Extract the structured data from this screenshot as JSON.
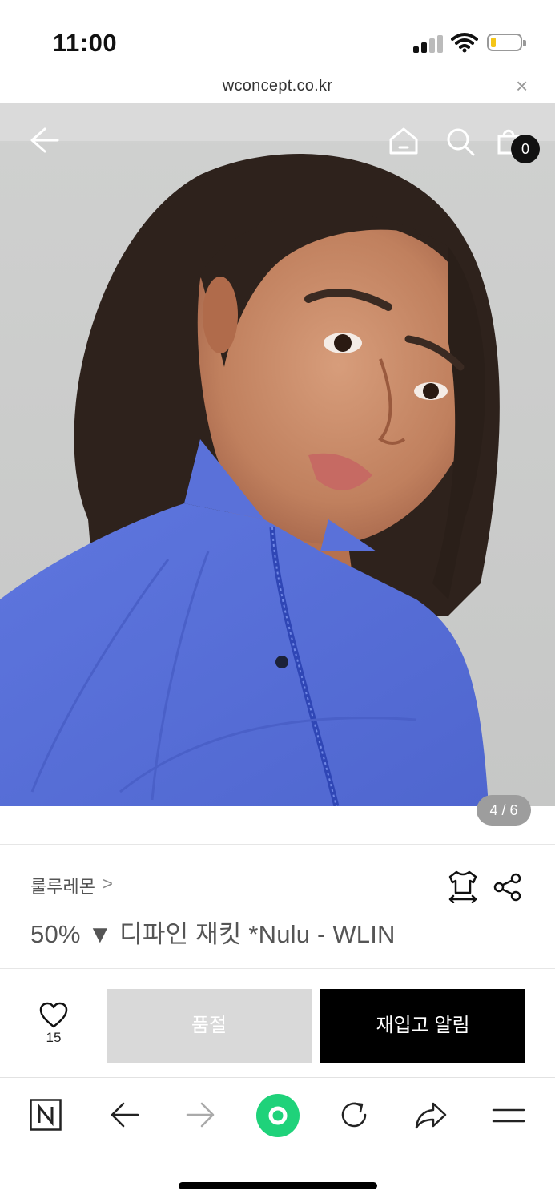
{
  "status_bar": {
    "time": "11:00"
  },
  "browser": {
    "url": "wconcept.co.kr",
    "close_symbol": "×"
  },
  "header": {
    "cart_count": "0"
  },
  "gallery": {
    "counter": "4 / 6"
  },
  "product": {
    "brand": "룰루레몬",
    "brand_chevron": ">",
    "title": "50% ▼ 디파인 재킷 *Nulu - WLIN"
  },
  "actions": {
    "wish_count": "15",
    "sold_out_label": "품절",
    "restock_label": "재입고 알림"
  },
  "colors": {
    "jacket_blue": "#5a72d8",
    "accent_green": "#1fd27a",
    "badge_black": "#111111",
    "sold_out_gray": "#d9d9d9"
  },
  "icons": {
    "back": "arrow-left-icon",
    "home": "home-icon",
    "search": "search-icon",
    "cart": "shopping-bag-icon",
    "size": "shirt-size-icon",
    "share": "share-icon",
    "wish": "heart-icon",
    "toolbar": [
      "naver-n-icon",
      "arrow-left-icon",
      "arrow-right-icon",
      "green-dot-icon",
      "refresh-icon",
      "share-arrow-icon",
      "menu-icon"
    ]
  }
}
